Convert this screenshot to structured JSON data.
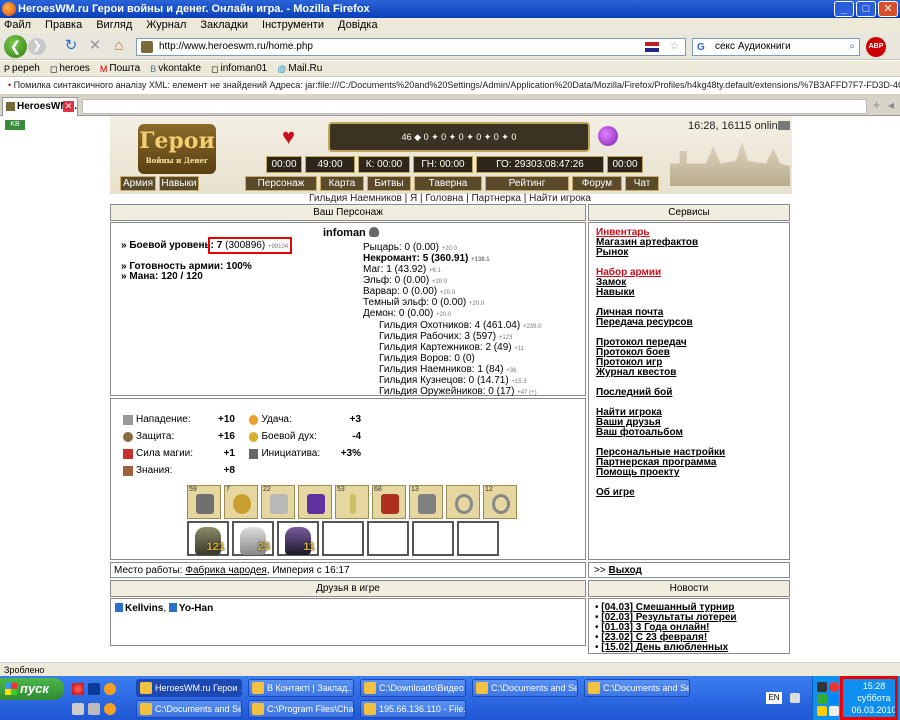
{
  "window": {
    "title": "HeroesWM.ru Герои войны и денег. Онлайн игра. - Mozilla Firefox",
    "min": "_",
    "max": "□",
    "close": "✕"
  },
  "menu": [
    "Файл",
    "Правка",
    "Вигляд",
    "Журнал",
    "Закладки",
    "Інструменти",
    "Довідка"
  ],
  "nav": {
    "url": "http://www.heroeswm.ru/home.php",
    "search_value": "секс Аудиокниги",
    "search_engine": "G",
    "abp": "ABP"
  },
  "bookmarks": [
    "pepeh",
    "heroes",
    "Пошта",
    "vkontakte",
    "infoman01",
    "Mail.Ru"
  ],
  "notice": "Помилка синтаксичного аналізу XML: елемент не знайдений Адреса: jar:file:///C:/Documents%20and%20Settings/Admin/Application%20Data/Mozilla/Firefox/Profiles/h4kg48ty.default/extensions/%7B3AFFD7F7-FD3D-4C9D-8F83-03296A1A8840%7D/chrome",
  "tab": {
    "label": "HeroesWM..."
  },
  "site": {
    "kb": "KB",
    "logo": "Герои",
    "logo_sub": "Войны и Денег",
    "online": "16:28, 16115 online",
    "resources": "46 ◆ 0 ✦ 0 ✦ 0 ✦ 0 ✦ 0 ✦ 0",
    "timers": [
      {
        "label": "00:00"
      },
      {
        "label": "49:00"
      },
      {
        "label": "К: 00:00"
      },
      {
        "label": "ГН: 00:00"
      },
      {
        "label": "ГО: 29303:08:47:26"
      },
      {
        "label": "00:00"
      }
    ],
    "left_menu": [
      "Армия",
      "Навыки"
    ],
    "menu": [
      "Персонаж",
      "Карта",
      "Битвы",
      "Таверна",
      "Рейтинг",
      "Форум",
      "Чат"
    ],
    "sublinks": "Гильдия Наемников | Я | Головна | Партнерка | Найти игрока"
  },
  "character": {
    "header": "Ваш Персонаж",
    "name": "infoman",
    "level_label": "» Боевой уровень:",
    "level_value": "7",
    "level_exp": "(300896)",
    "level_next": "+99104",
    "army_ready": "» Готовность армии: 100%",
    "mana": "» Мана: 120 / 120",
    "classes": [
      {
        "text": "Рыцарь: 0 (0.00)",
        "sub": "+20.0"
      },
      {
        "text": "Некромант: 5 (360.91)",
        "sub": "+138.1",
        "bold": true
      },
      {
        "text": "Маг: 1 (43.92)",
        "sub": "+6.1"
      },
      {
        "text": "Эльф: 0 (0.00)",
        "sub": "+20.0"
      },
      {
        "text": "Варвар: 0 (0.00)",
        "sub": "+20.0"
      },
      {
        "text": "Темный эльф: 0 (0.00)",
        "sub": "+20.0"
      },
      {
        "text": "Демон: 0 (0.00)",
        "sub": "+20.0"
      }
    ],
    "guilds": [
      {
        "text": "Гильдия Охотников: 4 (461.04)",
        "sub": "+239.0"
      },
      {
        "text": "Гильдия Рабочих: 3 (597)",
        "sub": "+123"
      },
      {
        "text": "Гильдия Картежников: 2 (49)",
        "sub": "+11"
      },
      {
        "text": "Гильдия Воров: 0 (0)",
        "sub": ""
      },
      {
        "text": "Гильдия Наемников: 1 (84)",
        "sub": "+36"
      },
      {
        "text": "Гильдия Кузнецов: 0 (14.71)",
        "sub": "+15.3"
      },
      {
        "text": "Гильдия Оружейников: 0 (17)",
        "sub": "+47 (+)"
      }
    ]
  },
  "stats": [
    {
      "label": "Нападение:",
      "value": "+10"
    },
    {
      "label": "Удача:",
      "value": "+3"
    },
    {
      "label": "Защита:",
      "value": "+16"
    },
    {
      "label": "Боевой дух:",
      "value": "-4"
    },
    {
      "label": "Сила магии:",
      "value": "+1"
    },
    {
      "label": "Инициатива:",
      "value": "+3%"
    },
    {
      "label": "Знания:",
      "value": "+8"
    }
  ],
  "items": [
    "59",
    "7",
    "22",
    "",
    "",
    "53",
    "68",
    "13",
    "",
    "12"
  ],
  "units": [
    "121",
    "25",
    "11",
    "",
    "",
    "",
    ""
  ],
  "work": {
    "label": "Место работы:",
    "place": "Фабрика чародея",
    "rest": ", Империя с 16:17"
  },
  "friends": {
    "header": "Друзья в игре",
    "list": [
      "Kellvins",
      "Yo-Han"
    ]
  },
  "services": {
    "header": "Сервисы",
    "groups": [
      [
        "Инвентарь",
        "Магазин артефактов",
        "Рынок"
      ],
      [
        "Набор армии",
        "Замок",
        "Навыки"
      ],
      [
        "Личная почта",
        "Передача ресурсов"
      ],
      [
        "Протокол передач",
        "Протокол боев",
        "Протокол игр",
        "Журнал квестов"
      ],
      [
        "Последний бой"
      ],
      [
        "Найти игрока",
        "Ваши друзья",
        "Ваш фотоальбом"
      ],
      [
        "Персональные настройки",
        "Партнерская программа",
        "Помощь проекту"
      ],
      [
        "Об игре"
      ]
    ]
  },
  "logout": {
    "prefix": ">>",
    "label": "Выход"
  },
  "news": {
    "header": "Новости",
    "items": [
      {
        "date": "[04.03]",
        "title": "Смешанный турнир"
      },
      {
        "date": "[02.03]",
        "title": "Результаты лотереи"
      },
      {
        "date": "[01.03]",
        "title": "3 Года онлайн!"
      },
      {
        "date": "[23.02]",
        "title": "С 23 февраля!"
      },
      {
        "date": "[15.02]",
        "title": "День влюбленных"
      }
    ]
  },
  "statusbar": "Зроблено",
  "taskbar": {
    "start": "пуск",
    "buttons": [
      "HeroesWM.ru Герои ...",
      "В Контакті | Заклад...",
      "C:\\Downloads\\Видео",
      "C:\\Documents and Se...",
      "C:\\Documents and Se...",
      "C:\\Documents and Se...",
      "C:\\Program Files\\Cha...",
      "195.66.136.110 - File..."
    ],
    "lang": "EN",
    "time": "15:28",
    "day": "суббота",
    "date": "06.03.2010"
  }
}
